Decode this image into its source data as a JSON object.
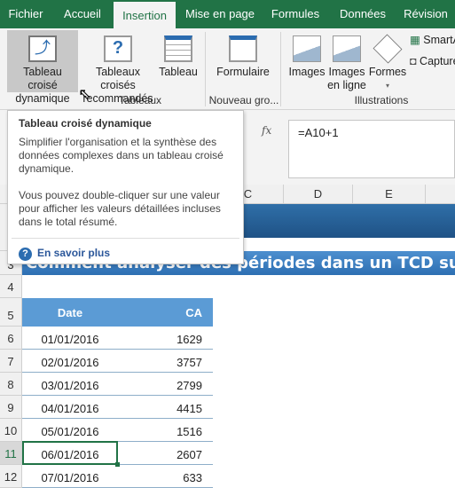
{
  "tabs": [
    "Fichier",
    "Accueil",
    "Insertion",
    "Mise en page",
    "Formules",
    "Données",
    "Révision"
  ],
  "active_tab": "Insertion",
  "ribbon": {
    "pivot": "Tableau croisé\ndynamique",
    "pivot_l1": "Tableau croisé",
    "pivot_l2": "dynamique",
    "rec_l1": "Tableaux croisés",
    "rec_l2": "recommandés",
    "table": "Tableau",
    "group_tables": "Tableaux",
    "form": "Formulaire",
    "group_new": "Nouveau gro...",
    "images": "Images",
    "online_l1": "Images",
    "online_l2": "en ligne",
    "shapes": "Formes",
    "smart": "SmartArt",
    "capture": "Capture",
    "group_ill": "Illustrations"
  },
  "formula": {
    "value": "=A10+1",
    "fx": "fx"
  },
  "columns": [
    "C",
    "D",
    "E"
  ],
  "tooltip": {
    "title": "Tableau croisé dynamique",
    "p1": "Simplifier l'organisation et la synthèse des données complexes dans un tableau croisé dynamique.",
    "p2": "Vous pouvez double-cliquer sur une valeur pour afficher les valeurs détaillées incluses dans le total résumé.",
    "link": "En savoir plus"
  },
  "sheet": {
    "title": "Comment analyser des périodes dans un TCD sur Excel",
    "headers": {
      "date": "Date",
      "ca": "CA"
    },
    "rows": [
      {
        "n": "6",
        "date": "01/01/2016",
        "ca": "1629"
      },
      {
        "n": "7",
        "date": "02/01/2016",
        "ca": "3757"
      },
      {
        "n": "8",
        "date": "03/01/2016",
        "ca": "2799"
      },
      {
        "n": "9",
        "date": "04/01/2016",
        "ca": "4415"
      },
      {
        "n": "10",
        "date": "05/01/2016",
        "ca": "1516"
      },
      {
        "n": "11",
        "date": "06/01/2016",
        "ca": "2607"
      },
      {
        "n": "12",
        "date": "07/01/2016",
        "ca": "633"
      }
    ],
    "row_numbers": [
      "3",
      "4",
      "5"
    ],
    "selected_row": "11"
  },
  "colors": {
    "accent": "#217346",
    "header_blue": "#5b9bd5",
    "title_blue": "#2d6fb2"
  }
}
